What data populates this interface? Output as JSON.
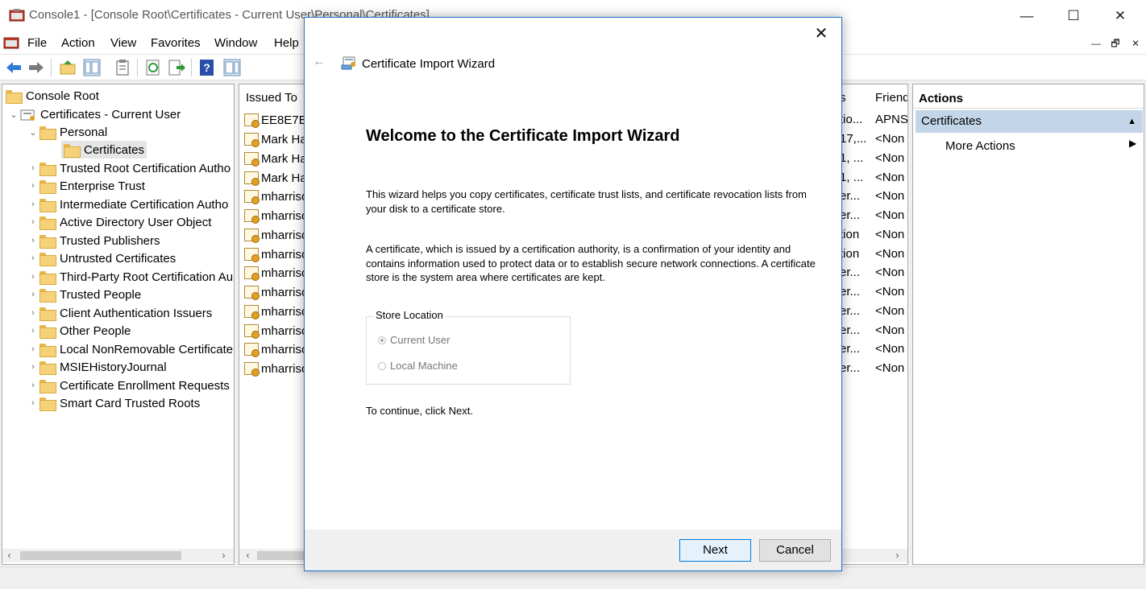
{
  "window": {
    "title": "Console1 - [Console Root\\Certificates - Current User\\Personal\\Certificates]",
    "minimize": "—",
    "maximize": "☐",
    "close": "✕"
  },
  "menu": {
    "items": [
      "File",
      "Action",
      "View",
      "Favorites",
      "Window",
      "Help"
    ],
    "mdi_minimize": "—",
    "mdi_restore": "🗗",
    "mdi_close": "✕"
  },
  "tree": {
    "root": "Console Root",
    "store": "Certificates - Current User",
    "personal": "Personal",
    "certificates": "Certificates",
    "folders": [
      "Trusted Root Certification Autho",
      "Enterprise Trust",
      "Intermediate Certification Autho",
      "Active Directory User Object",
      "Trusted Publishers",
      "Untrusted Certificates",
      "Third-Party Root Certification Au",
      "Trusted People",
      "Client Authentication Issuers",
      "Other People",
      "Local NonRemovable Certificate",
      "MSIEHistoryJournal",
      "Certificate Enrollment Requests",
      "Smart Card Trusted Roots"
    ]
  },
  "list": {
    "col_issued_to": "Issued To",
    "col_s": "s",
    "col_friendly": "Friend",
    "rows": [
      {
        "issued_to": "EE8E7B6",
        "mid": "tio...",
        "friendly": "APNS"
      },
      {
        "issued_to": "Mark Ha",
        "mid": "17,...",
        "friendly": "<Non"
      },
      {
        "issued_to": "Mark Ha",
        "mid": "1, ...",
        "friendly": "<Non"
      },
      {
        "issued_to": "Mark Ha",
        "mid": "1, ...",
        "friendly": "<Non"
      },
      {
        "issued_to": "mharriso",
        "mid": "er...",
        "friendly": "<Non"
      },
      {
        "issued_to": "mharriso",
        "mid": "er...",
        "friendly": "<Non"
      },
      {
        "issued_to": "mharriso",
        "mid": "tion",
        "friendly": "<Non"
      },
      {
        "issued_to": "mharriso",
        "mid": "tion",
        "friendly": "<Non"
      },
      {
        "issued_to": "mharriso",
        "mid": "er...",
        "friendly": "<Non"
      },
      {
        "issued_to": "mharriso",
        "mid": "er...",
        "friendly": "<Non"
      },
      {
        "issued_to": "mharriso",
        "mid": "er...",
        "friendly": "<Non"
      },
      {
        "issued_to": "mharriso",
        "mid": "er...",
        "friendly": "<Non"
      },
      {
        "issued_to": "mharriso",
        "mid": "er...",
        "friendly": "<Non"
      },
      {
        "issued_to": "mharriso",
        "mid": "er...",
        "friendly": "<Non"
      }
    ]
  },
  "actions": {
    "header": "Actions",
    "section": "Certificates",
    "section_caret": "▲",
    "more": "More Actions",
    "more_arrow": "▶"
  },
  "dialog": {
    "back": "←",
    "close": "✕",
    "title": "Certificate Import Wizard",
    "heading": "Welcome to the Certificate Import Wizard",
    "para1": "This wizard helps you copy certificates, certificate trust lists, and certificate revocation lists from your disk to a certificate store.",
    "para2": "A certificate, which is issued by a certification authority, is a confirmation of your identity and contains information used to protect data or to establish secure network connections. A certificate store is the system area where certificates are kept.",
    "store_location_label": "Store Location",
    "option_current_user": "Current User",
    "option_local_machine": "Local Machine",
    "selected_option": "Current User",
    "continue_text": "To continue, click Next.",
    "next_label": "Next",
    "cancel_label": "Cancel"
  },
  "colors": {
    "selection": "#c3d6e9",
    "dialog_border": "#1e72c8",
    "folder": "#f5d27a"
  }
}
